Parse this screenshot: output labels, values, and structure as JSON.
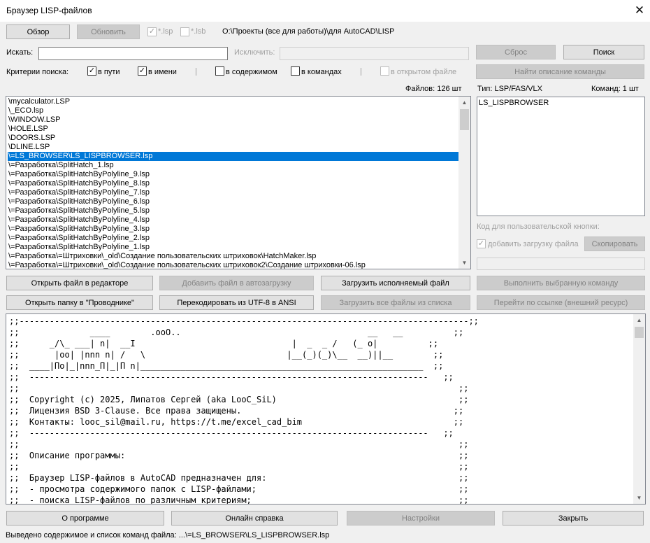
{
  "window": {
    "title": "Браузер LISP-файлов",
    "close_glyph": "✕"
  },
  "toolbar": {
    "browse_label": "Обзор",
    "refresh_label": "Обновить",
    "lsp_label": "*.lsp",
    "lsb_label": "*.lsb",
    "current_path": "O:\\Проекты (все для работы)\\для AutoCAD\\LISP"
  },
  "search": {
    "label": "Искать:",
    "value": "",
    "exclude_label": "Исключить:",
    "exclude_value": "",
    "reset_label": "Сброс",
    "search_label": "Поиск",
    "criteria_label": "Критерии поиска:",
    "in_path_label": "в пути",
    "in_name_label": "в имени",
    "in_content_label": "в содержимом",
    "in_commands_label": "в командах",
    "in_open_file_label": "в открытом файле",
    "find_command_desc_label": "Найти описание команды"
  },
  "files": {
    "count_label": "Файлов: 126 шт",
    "items": [
      "\\mycalculator.LSP",
      "\\_ECO.lsp",
      "\\WINDOW.LSP",
      "\\HOLE.LSP",
      "\\DOORS.LSP",
      "\\DLINE.LSP",
      "\\=LS_BROWSER\\LS_LISPBROWSER.lsp",
      "\\=Разработка\\SplitHatch_1.lsp",
      "\\=Разработка\\SplitHatchByPolyline_9.lsp",
      "\\=Разработка\\SplitHatchByPolyline_8.lsp",
      "\\=Разработка\\SplitHatchByPolyline_7.lsp",
      "\\=Разработка\\SplitHatchByPolyline_6.lsp",
      "\\=Разработка\\SplitHatchByPolyline_5.lsp",
      "\\=Разработка\\SplitHatchByPolyline_4.lsp",
      "\\=Разработка\\SplitHatchByPolyline_3.lsp",
      "\\=Разработка\\SplitHatchByPolyline_2.lsp",
      "\\=Разработка\\SplitHatchByPolyline_1.lsp",
      "\\=Разработка\\=Штриховки\\_old\\Создание пользовательских штриховок\\HatchMaker.lsp",
      "\\=Разработка\\=Штриховки\\_old\\Создание пользовательских штриховок2\\Создание штриховки-06.lsp"
    ]
  },
  "commands": {
    "type_label": "Тип: LSP/FAS/VLX",
    "count_label": "Команд: 1 шт",
    "items": [
      "LS_LISPBROWSER"
    ],
    "custom_button_code_label": "Код для пользовательской кнопки:",
    "add_file_load_label": "добавить загрузку файла",
    "copy_label": "Скопировать",
    "code_value": ""
  },
  "actions": {
    "open_in_editor": "Открыть файл в редакторе",
    "add_to_autoload": "Добавить файл в автозагрузку",
    "load_executable": "Загрузить исполняемый файл",
    "run_selected_command": "Выполнить выбранную команду",
    "open_folder_explorer": "Открыть папку в \"Проводнике\"",
    "recode_utf8": "Перекодировать из UTF-8 в ANSI",
    "load_all_files": "Загрузить все файлы из списка",
    "go_to_link": "Перейти по ссылке (внешний ресурс)"
  },
  "code": {
    "lines": [
      ";;-----------------------------------------------------------------------------------------;;",
      ";;              ____        .ooO..                                     __   __          ;;",
      ";;      _/\\_ ___| n|  __I                               |  _  _ /   (_ o|          ;;",
      ";;       |oo| |nnn n| /   \\                            |__(_)(_)\\__  __)||__        ;;",
      ";;  ____|По|_|nnn_П|_|П n|________________________________________________________  ;;",
      ";;  -------------------------------------------------------------------------------   ;;",
      ";;                                                                                       ;;",
      ";;  Copyright (c) 2025, Липатов Сергей (aka LooC_SiL)                                    ;;",
      ";;  Лицензия BSD 3-Clause. Все права защищены.                                          ;;",
      ";;  Контакты: looc_sil@mail.ru, https://t.me/excel_cad_bim                              ;;",
      ";;  -------------------------------------------------------------------------------   ;;",
      ";;                                                                                       ;;",
      ";;  Описание программы:                                                                  ;;",
      ";;                                                                                       ;;",
      ";;  Браузер LISP-файлов в AutoCAD предназначен для:                                      ;;",
      ";;  - просмотра содержимого папок с LISP-файлами;                                        ;;",
      ";;  - поиска LISP-файлов по различным критериям;                                         ;;"
    ]
  },
  "bottom": {
    "about": "О программе",
    "online_help": "Онлайн справка",
    "settings": "Настройки",
    "close": "Закрыть"
  },
  "status": {
    "text": "Выведено содержимое и список команд файла: ...\\=LS_BROWSER\\LS_LISPBROWSER.lsp"
  }
}
